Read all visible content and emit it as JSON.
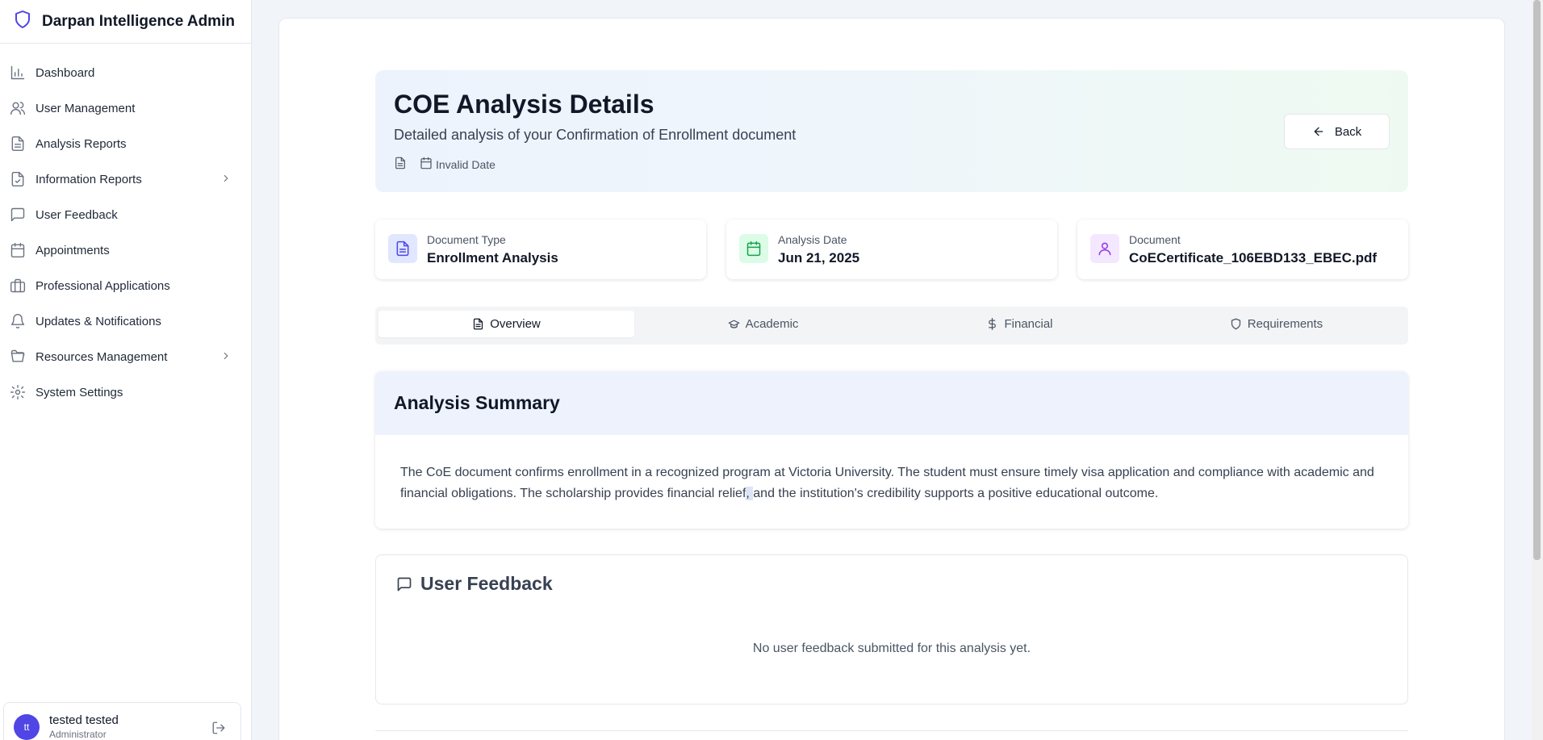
{
  "app": {
    "title": "Darpan Intelligence Admin"
  },
  "sidebar": {
    "items": [
      {
        "label": "Dashboard",
        "icon": "bar-chart-icon"
      },
      {
        "label": "User Management",
        "icon": "users-icon"
      },
      {
        "label": "Analysis Reports",
        "icon": "file-text-icon"
      },
      {
        "label": "Information Reports",
        "icon": "file-check-icon"
      },
      {
        "label": "User Feedback",
        "icon": "message-square-icon"
      },
      {
        "label": "Appointments",
        "icon": "calendar-icon"
      },
      {
        "label": "Professional Applications",
        "icon": "building-icon"
      },
      {
        "label": "Updates & Notifications",
        "icon": "bell-icon"
      },
      {
        "label": "Resources Management",
        "icon": "folder-open-icon"
      },
      {
        "label": "System Settings",
        "icon": "gear-icon"
      }
    ],
    "user": {
      "initials": "tt",
      "name": "tested tested",
      "role": "Administrator"
    }
  },
  "header": {
    "title": "COE Analysis Details",
    "subtitle": "Detailed analysis of your Confirmation of Enrollment document",
    "date": "Invalid Date",
    "back_label": "Back"
  },
  "stats": [
    {
      "label": "Document Type",
      "value": "Enrollment Analysis",
      "color": "#4f46e5"
    },
    {
      "label": "Analysis Date",
      "value": "Jun 21, 2025",
      "color": "#16a34a"
    },
    {
      "label": "Document",
      "value": "CoECertificate_106EBD133_EBEC.pdf",
      "color": "#9333ea"
    }
  ],
  "tabs": [
    {
      "label": "Overview",
      "active": true
    },
    {
      "label": "Academic"
    },
    {
      "label": "Financial"
    },
    {
      "label": "Requirements"
    }
  ],
  "summary": {
    "title": "Analysis Summary",
    "text_before": "The CoE document confirms enrollment in a recognized program at Victoria University. The student must ensure timely visa application and compliance with academic and financial obligations. The scholarship provides financial relief",
    "text_highlight": ", ",
    "text_after": "and the institution's credibility supports a positive educational outcome."
  },
  "feedback": {
    "title": "User Feedback",
    "empty": "No user feedback submitted for this analysis yet."
  }
}
